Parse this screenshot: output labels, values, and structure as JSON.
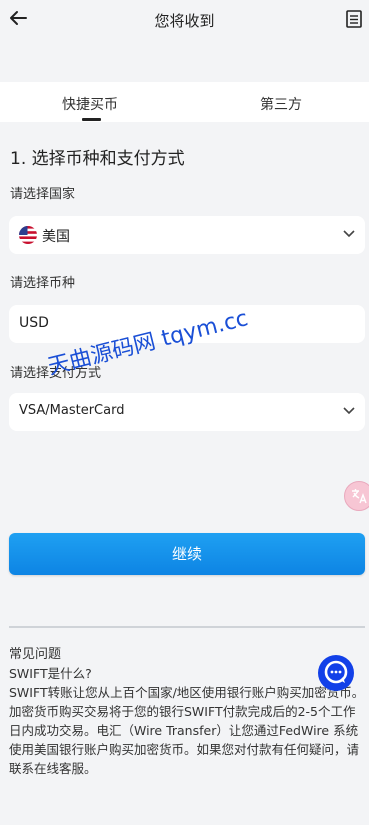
{
  "header": {
    "title": "您将收到"
  },
  "tabs": [
    {
      "label": "快捷买币"
    },
    {
      "label": "第三方"
    }
  ],
  "section": {
    "title": "1. 选择币种和支付方式"
  },
  "country": {
    "label": "请选择国家",
    "value": "美国"
  },
  "currency": {
    "label": "请选择币种",
    "value": "USD"
  },
  "payment": {
    "label": "请选择支付方式",
    "value": "VSA/MasterCard"
  },
  "continue_label": "继续",
  "watermark": "天曲源码网 tqym.cc",
  "faq": {
    "title": "常见问题",
    "question": "SWIFT是什么?",
    "answer": "SWIFT转账让您从上百个国家/地区使用银行账户购买加密货币。加密货币购买交易将于您的银行SWIFT付款完成后的2-5个工作日内成功交易。电汇（Wire Transfer）让您通过FedWire 系统使用美国银行账户购买加密货币。如果您对付款有任何疑问，请联系在线客服。"
  },
  "colors": {
    "accent": "#0d84e4",
    "chat": "#1240e8",
    "background": "#f3f4f6"
  },
  "icons": [
    "back-arrow-icon",
    "document-icon",
    "us-flag-icon",
    "chevron-down-icon",
    "translate-icon",
    "chat-icon"
  ]
}
